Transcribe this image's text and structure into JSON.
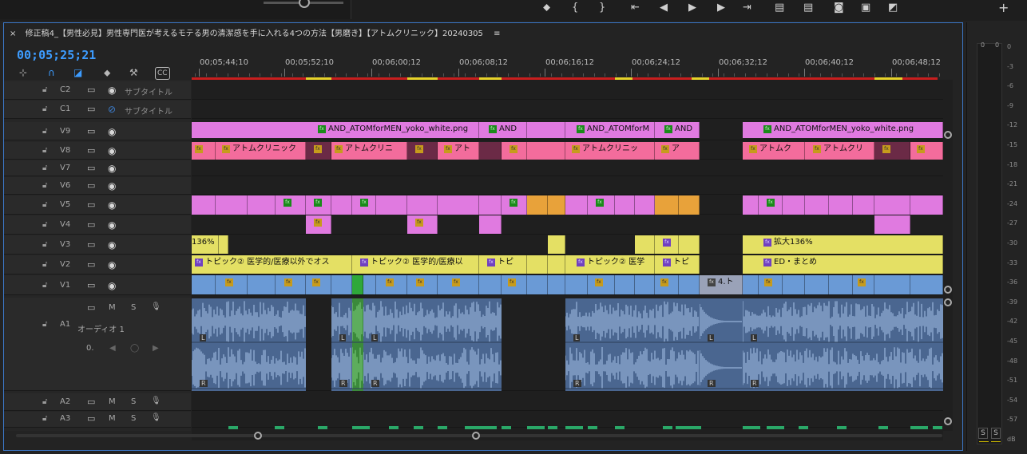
{
  "sequence": {
    "title": "修正稿4_【男性必見】男性専門医が考えるモテる男の清潔感を手に入れる4つの方法【男磨き】【アトムクリニック】20240305",
    "timecode": "00;05;25;21"
  },
  "toolbar": {
    "close": "×",
    "menu": "≡",
    "add": "+"
  },
  "ruler": {
    "labels": [
      "00;05;44;10",
      "00;05;52;10",
      "00;06;00;12",
      "00;06;08;12",
      "00;06;16;12",
      "00;06;24;12",
      "00;06;32;12",
      "00;06;40;12",
      "00;06;48;12"
    ]
  },
  "tracks": {
    "C2": {
      "name": "C2",
      "label": "サブタイトル"
    },
    "C1": {
      "name": "C1",
      "label": "サブタイトル"
    },
    "V9": {
      "name": "V9"
    },
    "V8": {
      "name": "V8"
    },
    "V7": {
      "name": "V7"
    },
    "V6": {
      "name": "V6"
    },
    "V5": {
      "name": "V5"
    },
    "V4": {
      "name": "V4"
    },
    "V3": {
      "name": "V3"
    },
    "V2": {
      "name": "V2"
    },
    "V1": {
      "name": "V1"
    },
    "A1": {
      "name": "A1",
      "label": "オーディオ 1",
      "mute": "M",
      "solo": "S",
      "vol": "0."
    },
    "A2": {
      "name": "A2",
      "mute": "M",
      "solo": "S"
    },
    "A3": {
      "name": "A3",
      "mute": "M",
      "solo": "S"
    }
  },
  "clips": {
    "v9_a": "AND_ATOMforMEN_yoko_white.png",
    "v9_b": "AND",
    "v9_c": "AND_ATOMforM",
    "v9_d": "AND",
    "v9_e": "AND_ATOMforMEN_yoko_white.png",
    "v8_a": "アトムクリニック",
    "v8_b": "アトムクリニ",
    "v8_c": "アト",
    "v8_d": "アトムクリニッ",
    "v8_e": "ア",
    "v8_f": "アトムク",
    "v8_g": "アトムクリ",
    "v3_a": "136%",
    "v3_b": "拡大136%",
    "v2_a": "トピック② 医学的/医療以外でオス",
    "v2_b": "トピック② 医学的/医療以",
    "v2_c": "トピ",
    "v2_d": "トピック② 医学",
    "v2_e": "トピ",
    "v2_f": "ED・まとめ",
    "v1_a": "4.ト",
    "audio_ch_l": "L",
    "audio_ch_r": "R"
  },
  "meter": {
    "scale": [
      "0",
      "-3",
      "-6",
      "-9",
      "-12",
      "-15",
      "-18",
      "-21",
      "-24",
      "-27",
      "-30",
      "-33",
      "-36",
      "-39",
      "-42",
      "-45",
      "-48",
      "-51",
      "-54",
      "-57",
      "dB"
    ],
    "solo_left": "S",
    "solo_right": "S",
    "top_left": "0",
    "top_right": "0"
  },
  "colors": {
    "accent": "#3d9cff",
    "work_area": "#c81e1e",
    "clip_pink": "#e07ae0",
    "clip_rose": "#f36c9c",
    "clip_yellow": "#e4e064",
    "clip_blue": "#6a9ad6",
    "audio": "#4a6690"
  }
}
